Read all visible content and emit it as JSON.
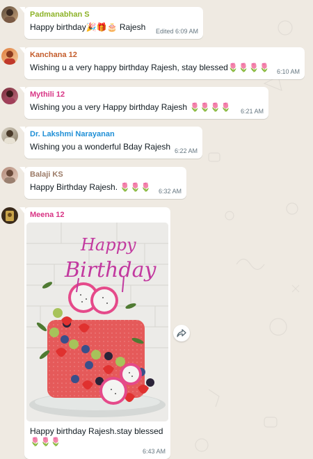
{
  "messages": [
    {
      "sender": "Padmanabhan S",
      "sender_color": "#8db328",
      "text": "Happy birthday",
      "suffix": "Rajesh",
      "emojis": "🎉🎁🎂",
      "meta": "Edited 6:09 AM"
    },
    {
      "sender": "Kanchana 12",
      "sender_color": "#c45d2c",
      "text": "Wishing u a very happy birthday Rajesh, stay blessed",
      "emojis": "🌷🌷🌷🌷",
      "meta": "6:10 AM"
    },
    {
      "sender": "Mythili 12",
      "sender_color": "#d83484",
      "text": "Wishing you a very Happy birthday Rajesh",
      "emojis": "🌷🌷🌷🌷",
      "meta": "6:21 AM"
    },
    {
      "sender": "Dr. Lakshmi Narayanan",
      "sender_color": "#1f8fd6",
      "text": "Wishing you a wonderful Bday Rajesh",
      "emojis": "",
      "meta": "6:22 AM"
    },
    {
      "sender": "Balaji KS",
      "sender_color": "#9b7a66",
      "text": "Happy Birthday Rajesh.",
      "emojis": "🌷🌷🌷",
      "meta": "6:32 AM"
    },
    {
      "sender": "Meena 12",
      "sender_color": "#d83484",
      "text": "Happy birthday Rajesh.stay blessed",
      "emojis": "🌷🌷🌷",
      "meta": "6:43 AM"
    }
  ],
  "cake_topper": {
    "line1": "Happy",
    "line2": "Birthday"
  },
  "icons": {
    "forward": "forward-icon"
  },
  "colors": {
    "background": "#efeae2",
    "bubble": "#ffffff",
    "meta": "#667781"
  }
}
